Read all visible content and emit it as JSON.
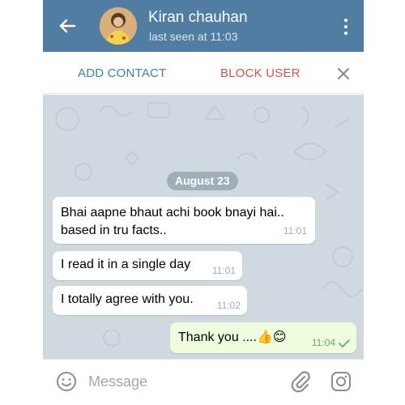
{
  "header": {
    "contact_name": "Kiran chauhan",
    "last_seen": "last seen at 11:03",
    "back_icon": "arrow-left-icon",
    "menu_icon": "more-vertical-icon",
    "bar_color": "#517da2"
  },
  "actions": {
    "add_contact": "ADD CONTACT",
    "block_user": "BLOCK USER",
    "close_icon": "close-icon"
  },
  "chat": {
    "date_label": "August 23",
    "messages": [
      {
        "direction": "incoming",
        "text_line1": "Bhai aapne bhaut achi book bnayi hai..",
        "text_line2": "based in tru facts..",
        "time": "11:01"
      },
      {
        "direction": "incoming",
        "text": "I read it in a single day",
        "time": "11:01"
      },
      {
        "direction": "incoming",
        "text": "I totally agree with you.",
        "time": "11:02"
      },
      {
        "direction": "outgoing",
        "text": "Thank you ....👍😊",
        "time": "11:04",
        "status": "sent-check"
      }
    ],
    "background_color": "#cfd9df",
    "outgoing_bubble_color": "#effdde"
  },
  "composer": {
    "placeholder": "Message",
    "value": "",
    "emoji_icon": "smile-icon",
    "attach_icon": "paperclip-icon",
    "camera_icon": "instagram-camera-icon"
  }
}
